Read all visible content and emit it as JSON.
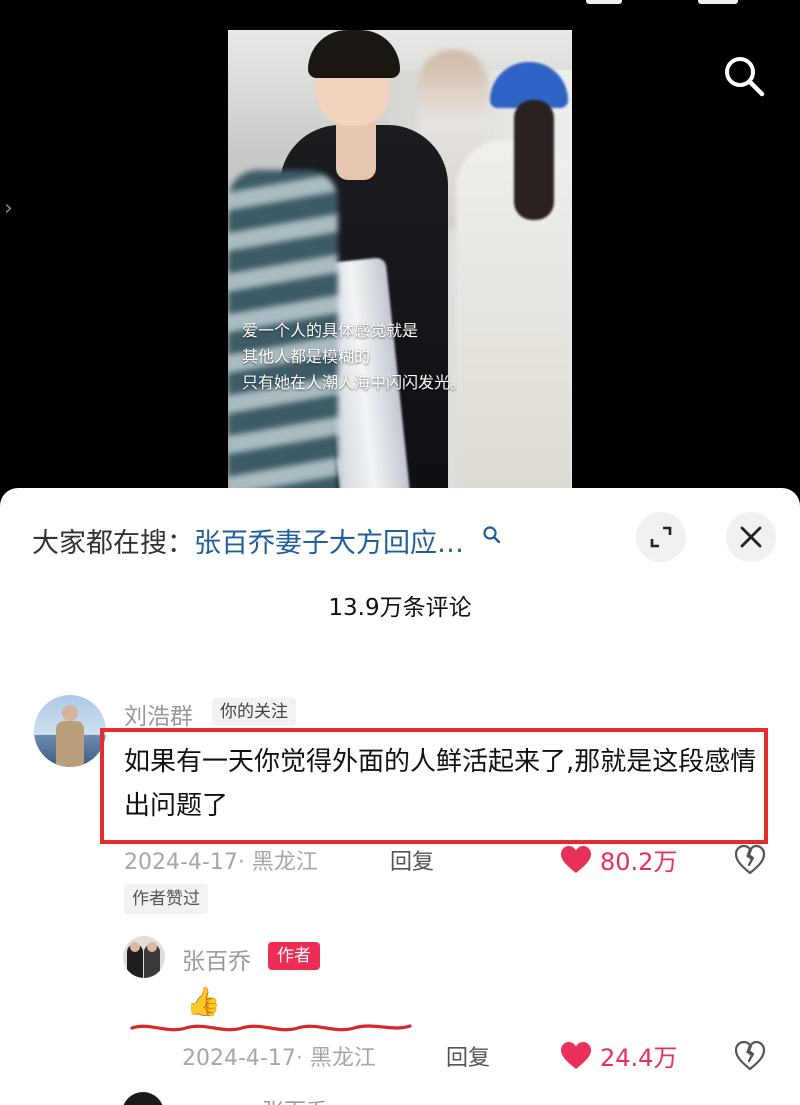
{
  "video": {
    "caption_lines": [
      "爱一个人的具体感觉就是",
      "其他人都是模糊的",
      "只有她在人潮人海中闪闪发光。"
    ],
    "search_icon": "search-icon",
    "side_icon": "chevron-right-icon"
  },
  "sheet": {
    "search_prefix": "大家都在搜：",
    "search_query": "张百乔妻子大方回应…",
    "expand_icon": "expand-icon",
    "close_icon": "close-icon",
    "comment_count": "13.9万条评论"
  },
  "comments": [
    {
      "username": "刘浩群",
      "follow_tag": "你的关注",
      "text": "如果有一天你觉得外面的人鲜活起来了,那就是这段感情出问题了",
      "meta": "2024-4-17· 黑龙江",
      "reply_label": "回复",
      "likes": "80.2万",
      "author_liked": "作者赞过"
    },
    {
      "username": "张百乔",
      "author_tag": "作者",
      "text": "👍",
      "meta": "2024-4-17· 黑龙江",
      "reply_label": "回复",
      "likes": "24.4万"
    }
  ],
  "next_comment": {
    "username": "张百乔"
  },
  "colors": {
    "accent_red": "#e8305a",
    "author_tag": "#ee2d55",
    "search_query": "#1f5f9b",
    "highlight_border": "#e52b2b"
  }
}
